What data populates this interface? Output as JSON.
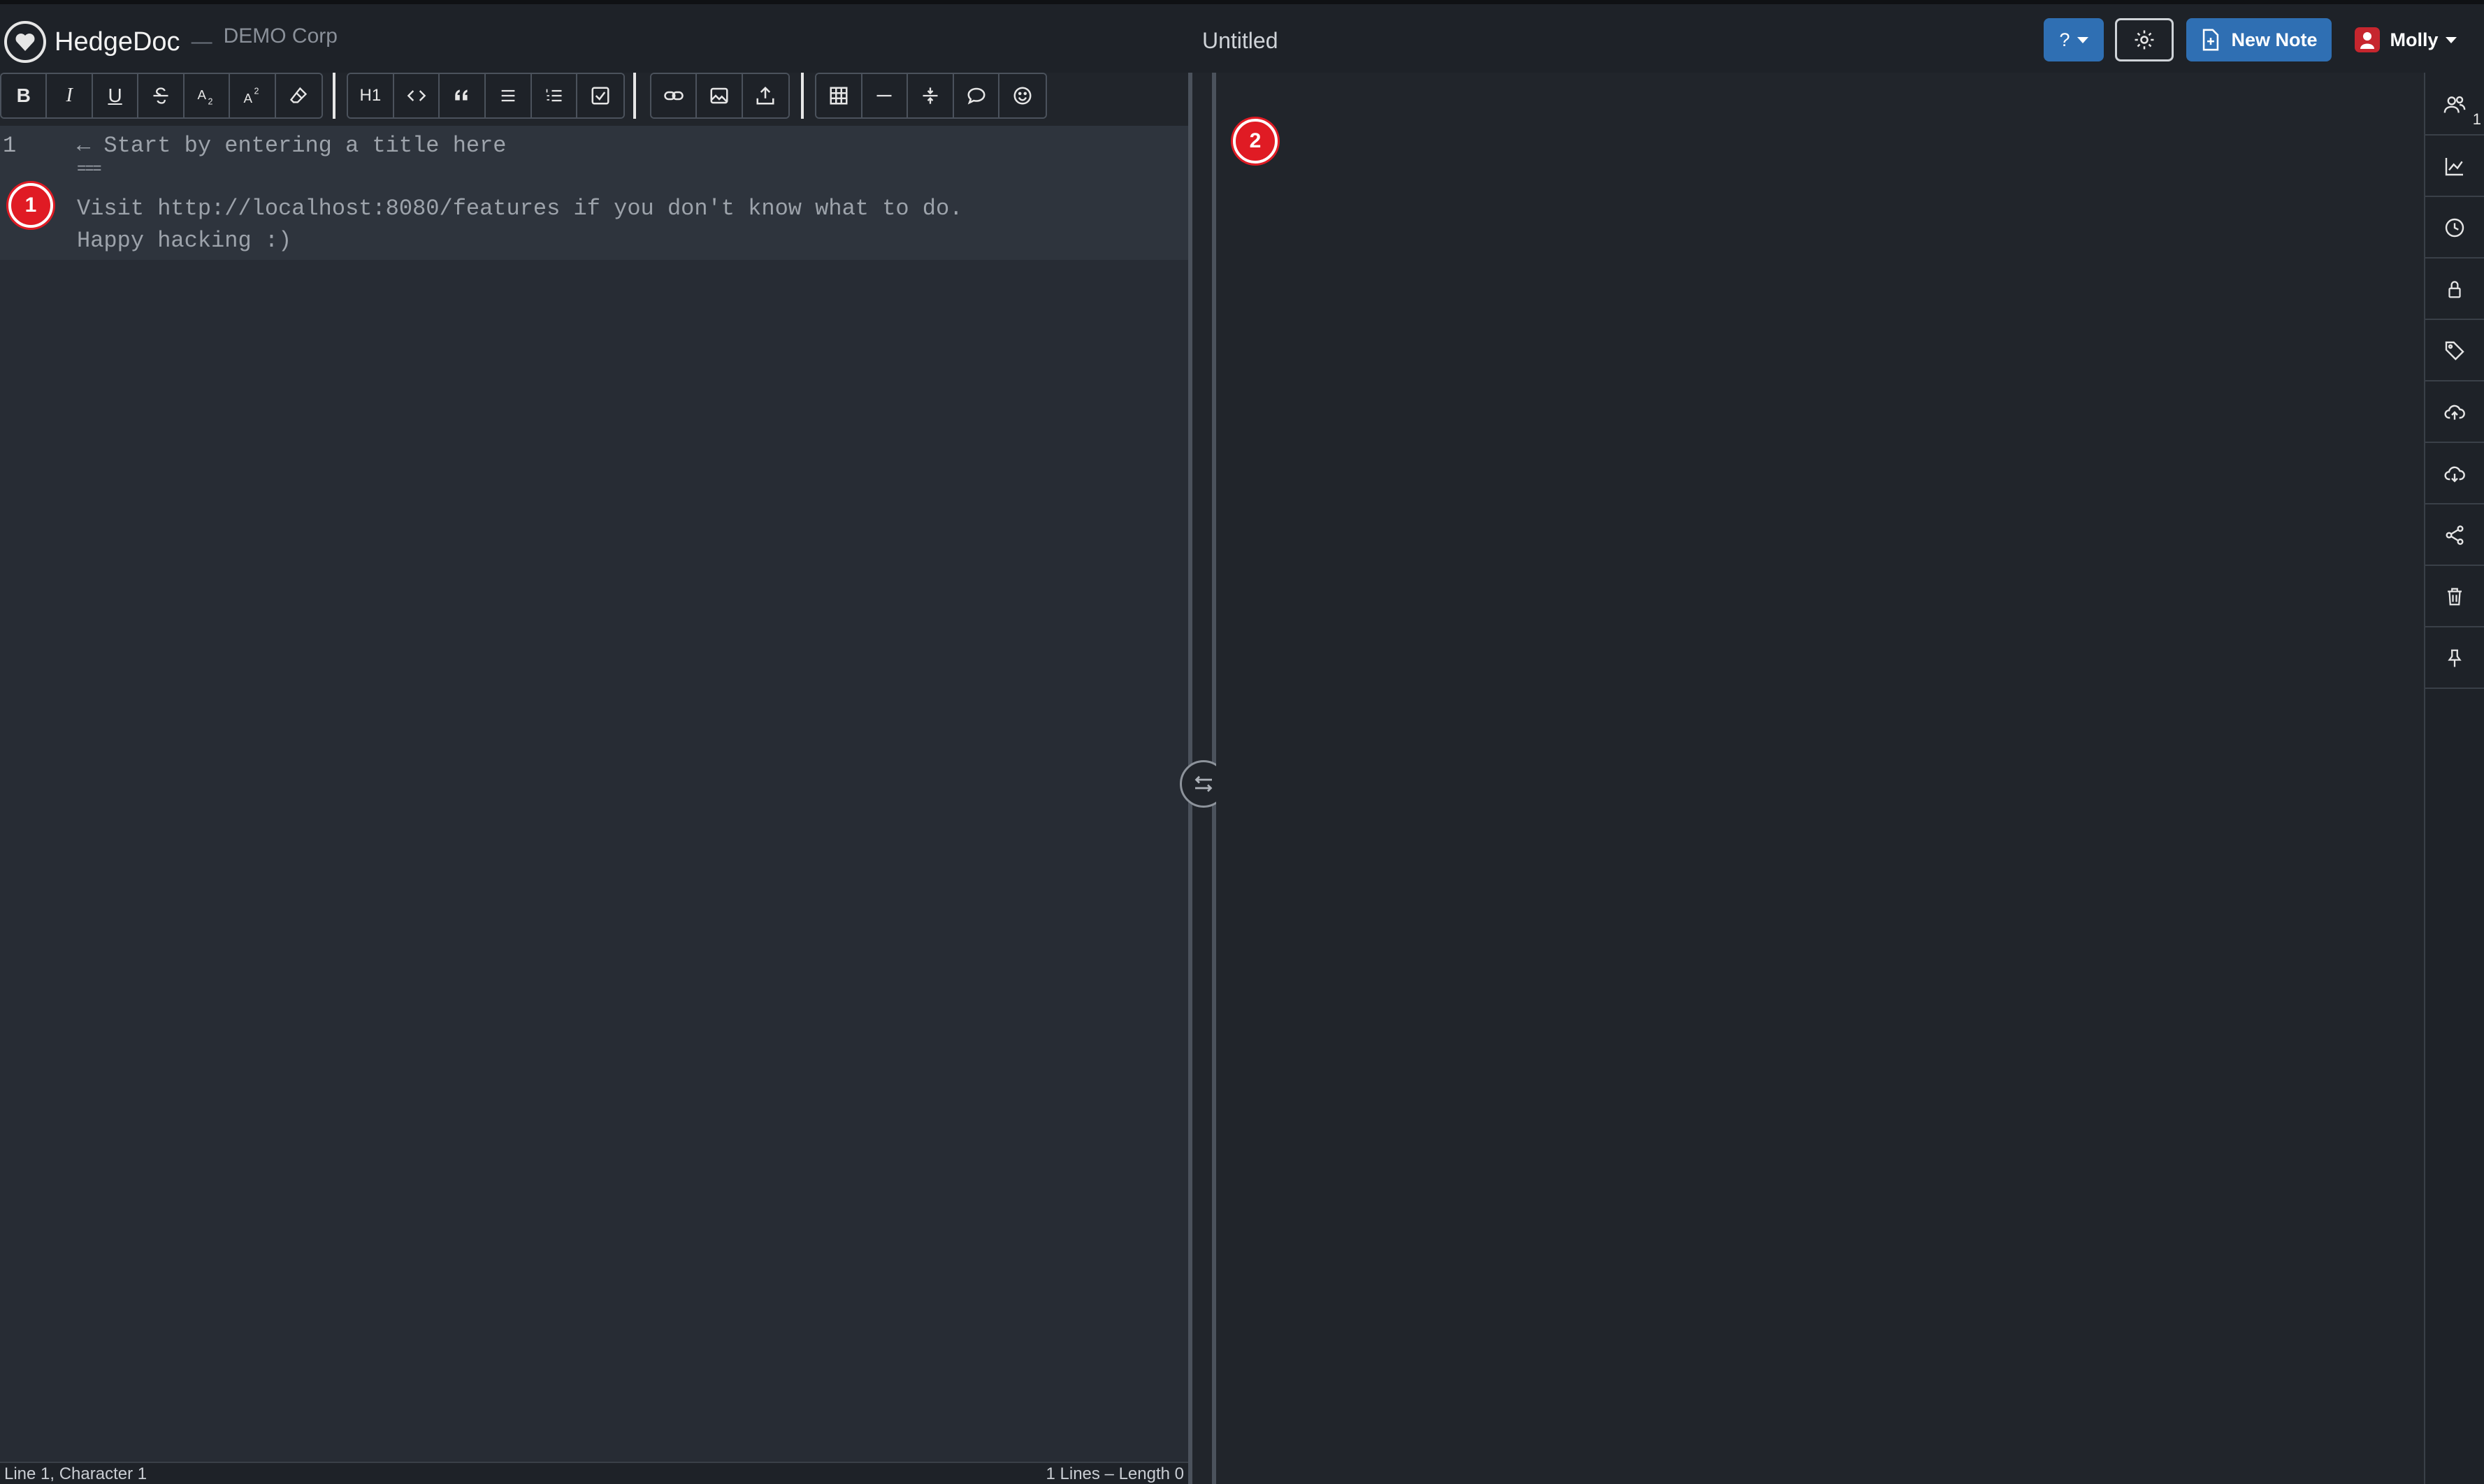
{
  "app": {
    "name": "HedgeDoc",
    "separator": "—",
    "org": "DEMO Corp",
    "note_title": "Untitled"
  },
  "header": {
    "help_label": "?",
    "new_note_label": "New Note",
    "user_name": "Molly"
  },
  "toolbar": {
    "groups": [
      [
        "bold-icon",
        "italic-icon",
        "underline-icon",
        "strikethrough-icon",
        "subscript-icon",
        "superscript-icon",
        "eraser-icon"
      ],
      [
        "heading-icon",
        "code-icon",
        "quote-icon",
        "bullet-list-icon",
        "ordered-list-icon",
        "checklist-icon"
      ],
      [
        "link-icon",
        "image-icon",
        "upload-icon"
      ],
      [
        "table-icon",
        "horizontal-rule-icon",
        "collapsible-icon",
        "comment-icon",
        "emoji-icon"
      ]
    ],
    "labels": {
      "bold": "B",
      "italic": "I",
      "underline": "U",
      "heading": "H1"
    }
  },
  "editor": {
    "line_number": "1",
    "placeholder_lines": [
      "← Start by entering a title here",
      "===",
      "Visit http://localhost:8080/features if you don't know what to do.",
      "Happy hacking :)"
    ]
  },
  "badges": {
    "editor": "1",
    "preview": "2"
  },
  "status": {
    "left": "Line 1, Character 1",
    "right": "1 Lines – Length 0"
  },
  "sidebar": {
    "items": [
      "users-icon",
      "chart-icon",
      "clock-icon",
      "lock-icon",
      "tags-icon",
      "cloud-upload-icon",
      "cloud-download-icon",
      "share-icon",
      "trash-icon",
      "pin-icon"
    ],
    "online_count": "1"
  },
  "colors": {
    "accent": "#2f6fb3",
    "badge": "#e01b24",
    "background": "#21252b",
    "editor_bg": "#272c34"
  }
}
